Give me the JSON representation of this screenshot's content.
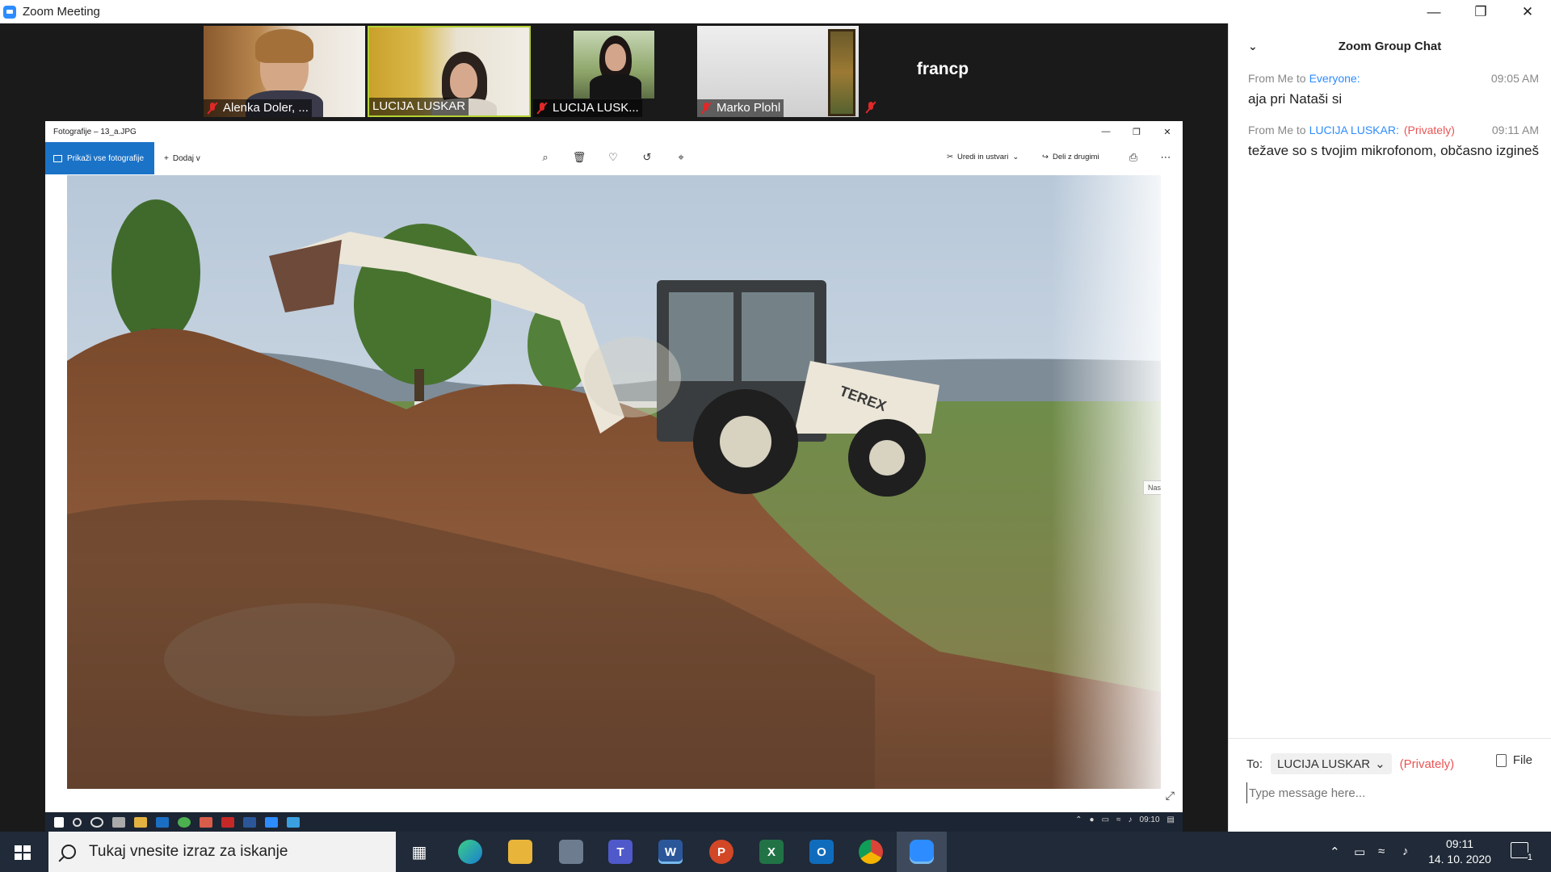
{
  "window": {
    "title": "Zoom Meeting"
  },
  "participants": [
    {
      "name": "Alenka Doler, ...",
      "muted": true
    },
    {
      "name": "LUCIJA LUSKAR",
      "muted": false,
      "active_speaker": true
    },
    {
      "name": "LUCIJA LUSK...",
      "muted": true
    },
    {
      "name": "Marko Plohl",
      "muted": true
    },
    {
      "name": "francp",
      "muted": true
    }
  ],
  "photos_app": {
    "title": "Fotografije – 13_a.JPG",
    "all_photos": "Prikaži vse fotografije",
    "add_to": "Dodaj v",
    "edit": "Uredi in ustvari",
    "share": "Deli z drugimi",
    "next_tooltip": "Naslednji"
  },
  "inner_taskbar": {
    "time": "09:10"
  },
  "chat": {
    "title": "Zoom Group Chat",
    "messages": [
      {
        "from": "From Me to",
        "to": "Everyone:",
        "privately": "",
        "time": "09:05 AM",
        "text": "aja pri Nataši si"
      },
      {
        "from": "From Me to",
        "to": "LUCIJA LUSKAR:",
        "privately": "(Privately)",
        "time": "09:11 AM",
        "text": "težave so s tvojim mikrofonom, občasno izgineš"
      }
    ],
    "to_label": "To:",
    "recipient": "LUCIJA LUSKAR",
    "recipient_privately": "(Privately)",
    "file_label": "File",
    "input_placeholder": "Type message here..."
  },
  "taskbar": {
    "search_placeholder": "Tukaj vnesite izraz za iskanje",
    "time": "09:11",
    "date": "14. 10. 2020",
    "notification_count": "1"
  },
  "colors": {
    "zoom_blue": "#2d8cff",
    "private_red": "#e95454",
    "mute_red": "#e02828",
    "photos_blue": "#1b73c8"
  }
}
